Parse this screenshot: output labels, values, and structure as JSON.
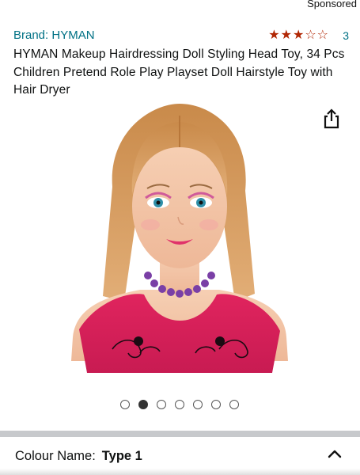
{
  "header": {
    "sponsored_label": "Sponsored"
  },
  "product": {
    "brand": "Brand: HYMAN",
    "rating_stars": 3,
    "rating_max": 5,
    "rating_count": "3",
    "title": "HYMAN Makeup Hairdressing Doll Styling Head Toy, 34 Pcs Children Pretend Role Play Playset Doll Hairstyle Toy with Hair Dryer"
  },
  "gallery": {
    "image_count": 7,
    "active_index": 1
  },
  "icons": {
    "share": "share-icon",
    "chevron": "chevron-up-icon"
  },
  "variation": {
    "label": "Colour Name:",
    "value": "Type 1"
  },
  "colors": {
    "link": "#007185",
    "star": "#b12704",
    "text": "#0f1111"
  }
}
